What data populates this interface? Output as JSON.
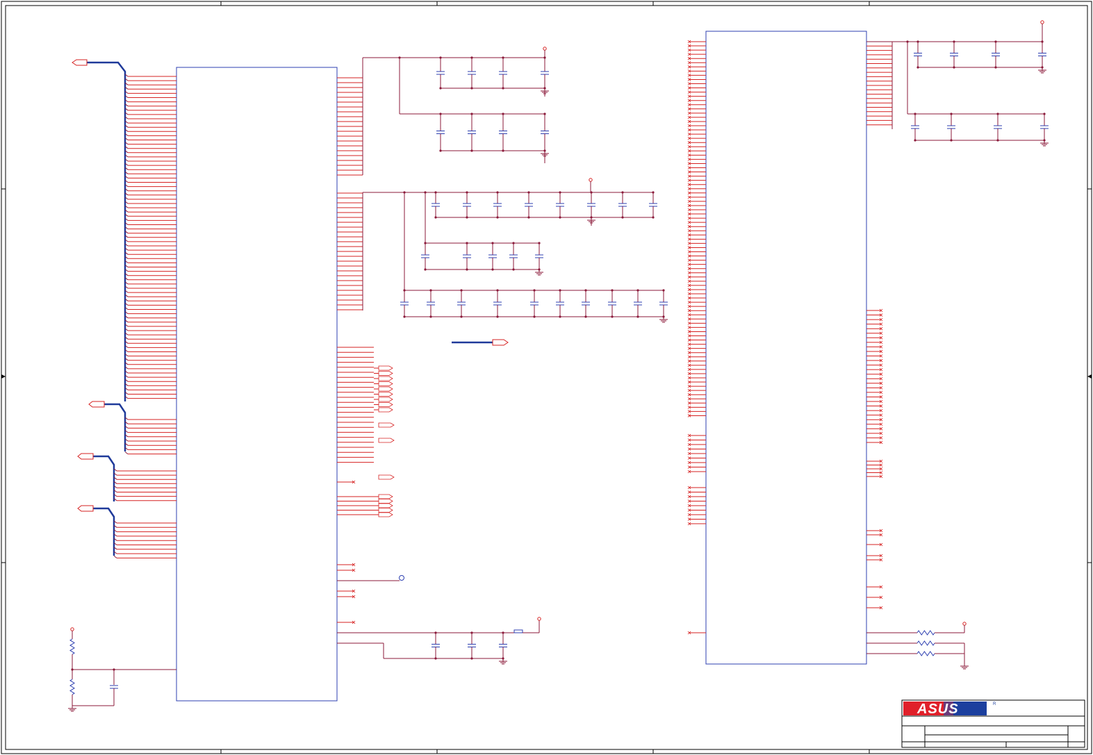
{
  "sheet": {
    "border_color": "#000000",
    "wire_color": "#8b1a3a",
    "pin_color": "#d62020",
    "part_color": "#2d3fb0",
    "bus_color": "#1f3a9a"
  },
  "title_block": {
    "logo_text": "ASUS",
    "logo_mark": "R",
    "logo_red": "#e0202a",
    "logo_blue": "#1c3f9e"
  }
}
